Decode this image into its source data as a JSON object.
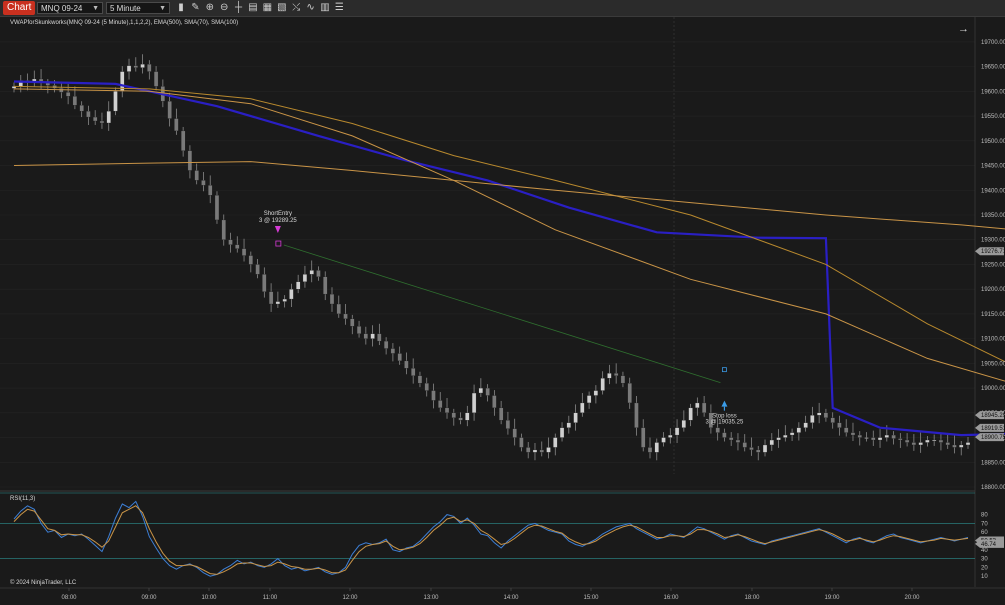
{
  "toolbar": {
    "chart_tab": "Chart",
    "instrument": "MNQ 09-24",
    "interval": "5 Minute",
    "icons": [
      "bar-type-icon",
      "draw-tool-icon",
      "zoom-in-icon",
      "zoom-out-icon",
      "crosshair-icon",
      "properties-icon",
      "data-box-icon",
      "templates-icon",
      "strategies-icon",
      "indicators-icon",
      "chart-trader-icon",
      "list-icon"
    ]
  },
  "colors": {
    "background": "#1a1a1a",
    "candle_up": "#d0d0d0",
    "candle_down": "#7a7a7a",
    "vwap": "#2a1fc4",
    "ema": "#c99447",
    "sma70": "#c99447",
    "sma100": "#b8892e",
    "rsi": "#3d7fd6",
    "rsi_avg": "#c99447",
    "short_entry": "#d63ad6",
    "stop_loss": "#3a9be6"
  },
  "chart_data": [
    {
      "type": "candlestick",
      "title": "VWAPforSkunkworks(MNQ 09-24 (5 Minute),1,1,2,2), EMA(500), SMA(70), SMA(100)",
      "ylim": [
        18800,
        19720
      ],
      "y_ticks": [
        "19700.00",
        "19650.00",
        "19600.00",
        "19550.00",
        "19500.00",
        "19450.00",
        "19400.00",
        "19350.00",
        "19300.00",
        "19250.00",
        "19200.00",
        "19150.00",
        "19100.00",
        "19050.00",
        "19000.00",
        "18950.00",
        "18900.00",
        "18850.00",
        "18800.00"
      ],
      "x_ticks": [
        "08:00",
        "09:00",
        "10:00",
        "11:00",
        "12:00",
        "13:00",
        "14:00",
        "15:00",
        "16:00",
        "18:00",
        "19:00",
        "20:00"
      ],
      "price_labels": [
        {
          "text": "19276.71",
          "value": 19276.71
        },
        {
          "text": "18945.29",
          "value": 18945.29
        },
        {
          "text": "18919.51",
          "value": 18919.51
        },
        {
          "text": "18900.75",
          "value": 18900.75
        }
      ],
      "candles_close": [
        19610,
        19622,
        19618,
        19625,
        19617,
        19612,
        19606,
        19598,
        19590,
        19572,
        19560,
        19548,
        19540,
        19536,
        19560,
        19600,
        19640,
        19652,
        19648,
        19655,
        19640,
        19610,
        19580,
        19545,
        19520,
        19480,
        19440,
        19420,
        19410,
        19390,
        19340,
        19300,
        19290,
        19282,
        19268,
        19250,
        19230,
        19195,
        19170,
        19175,
        19180,
        19200,
        19215,
        19230,
        19238,
        19225,
        19190,
        19170,
        19150,
        19140,
        19125,
        19110,
        19100,
        19110,
        19095,
        19080,
        19070,
        19055,
        19040,
        19025,
        19010,
        18995,
        18975,
        18960,
        18950,
        18940,
        18935,
        18950,
        18990,
        19000,
        18985,
        18960,
        18935,
        18918,
        18900,
        18880,
        18870,
        18875,
        18870,
        18880,
        18900,
        18920,
        18930,
        18950,
        18970,
        18985,
        18995,
        19020,
        19030,
        19025,
        19010,
        18970,
        18920,
        18880,
        18870,
        18890,
        18900,
        18905,
        18920,
        18935,
        18960,
        18970,
        18950,
        18920,
        18910,
        18900,
        18895,
        18890,
        18880,
        18875,
        18870,
        18885,
        18895,
        18900,
        18905,
        18910,
        18920,
        18930,
        18945,
        18950,
        18940,
        18930,
        18920,
        18910,
        18905,
        18900,
        18900,
        18895,
        18900,
        18905,
        18898,
        18895,
        18890,
        18885,
        18890,
        18895,
        18895,
        18890,
        18885,
        18880,
        18885,
        18890
      ],
      "series": [
        {
          "name": "VWAP",
          "points": [
            [
              0,
              19620
            ],
            [
              15,
              19615
            ],
            [
              30,
              19570
            ],
            [
              45,
              19510
            ],
            [
              58,
              19460
            ],
            [
              70,
              19420
            ],
            [
              82,
              19365
            ],
            [
              95,
              19315
            ],
            [
              110,
              19304
            ],
            [
              120,
              19303
            ],
            [
              121,
              18960
            ],
            [
              128,
              18920
            ],
            [
              140,
              18905
            ],
            [
              155,
              18910
            ],
            [
              170,
              18900
            ],
            [
              182,
              18895
            ]
          ]
        },
        {
          "name": "SMA(70)",
          "points": [
            [
              0,
              19605
            ],
            [
              20,
              19600
            ],
            [
              35,
              19575
            ],
            [
              50,
              19510
            ],
            [
              65,
              19420
            ],
            [
              80,
              19320
            ],
            [
              100,
              19220
            ],
            [
              120,
              19150
            ],
            [
              135,
              19060
            ],
            [
              150,
              19000
            ],
            [
              165,
              18965
            ],
            [
              182,
              18945
            ]
          ]
        },
        {
          "name": "SMA(100)",
          "points": [
            [
              0,
              19610
            ],
            [
              20,
              19605
            ],
            [
              35,
              19585
            ],
            [
              50,
              19535
            ],
            [
              65,
              19470
            ],
            [
              80,
              19420
            ],
            [
              100,
              19350
            ],
            [
              120,
              19250
            ],
            [
              135,
              19130
            ],
            [
              150,
              19030
            ],
            [
              165,
              18960
            ],
            [
              182,
              18920
            ]
          ]
        },
        {
          "name": "EMA(500)",
          "points": [
            [
              0,
              19450
            ],
            [
              20,
              19455
            ],
            [
              35,
              19458
            ],
            [
              50,
              19440
            ],
            [
              65,
              19420
            ],
            [
              80,
              19400
            ],
            [
              100,
              19375
            ],
            [
              120,
              19350
            ],
            [
              140,
              19330
            ],
            [
              160,
              19305
            ],
            [
              182,
              19276
            ]
          ]
        }
      ],
      "annotations": [
        {
          "text": "ShortEntry",
          "sub": "3 @ 19289.25",
          "bar": 39,
          "price": 19289.25
        },
        {
          "text": "Stop loss",
          "sub": "3 @ 19035.25",
          "bar": 105,
          "price": 19035.25
        }
      ],
      "ylabel": "",
      "xlabel": ""
    },
    {
      "type": "line",
      "title": "RSI(11,3)",
      "ylim": [
        0,
        100
      ],
      "y_ticks": [
        "80",
        "70",
        "60",
        "50",
        "40",
        "30",
        "20",
        "10"
      ],
      "series": [
        {
          "name": "RSI",
          "values": [
            75,
            84,
            90,
            86,
            70,
            60,
            62,
            54,
            58,
            56,
            58,
            52,
            45,
            38,
            55,
            76,
            92,
            88,
            95,
            78,
            55,
            42,
            30,
            22,
            18,
            22,
            24,
            20,
            14,
            10,
            12,
            18,
            22,
            28,
            24,
            26,
            22,
            20,
            24,
            30,
            22,
            18,
            20,
            16,
            18,
            20,
            15,
            12,
            14,
            20,
            35,
            45,
            48,
            46,
            48,
            52,
            40,
            38,
            42,
            44,
            50,
            58,
            66,
            72,
            80,
            78,
            70,
            76,
            68,
            58,
            56,
            48,
            42,
            50,
            56,
            62,
            68,
            70,
            66,
            62,
            60,
            58,
            50,
            46,
            44,
            48,
            52,
            58,
            62,
            66,
            68,
            70,
            64,
            60,
            56,
            52,
            54,
            58,
            56,
            54,
            60,
            66,
            64,
            60,
            56,
            52,
            56,
            58,
            54,
            50,
            48,
            46,
            50,
            52,
            54,
            56,
            58,
            60,
            62,
            64,
            60,
            56,
            52,
            48,
            52,
            54,
            50,
            48,
            52,
            56,
            58,
            54,
            52,
            50,
            48,
            50,
            52,
            54,
            52,
            50,
            52,
            54
          ]
        },
        {
          "name": "RSI Avg",
          "values": [
            72,
            80,
            86,
            84,
            74,
            64,
            62,
            57,
            58,
            57,
            57,
            54,
            49,
            43,
            50,
            66,
            82,
            86,
            90,
            82,
            64,
            49,
            36,
            27,
            22,
            22,
            23,
            21,
            17,
            13,
            12,
            15,
            19,
            24,
            25,
            25,
            23,
            21,
            22,
            26,
            24,
            21,
            20,
            18,
            18,
            19,
            17,
            14,
            14,
            17,
            28,
            38,
            44,
            46,
            47,
            50,
            44,
            40,
            41,
            43,
            47,
            54,
            62,
            68,
            75,
            77,
            72,
            74,
            70,
            62,
            58,
            52,
            46,
            48,
            53,
            59,
            65,
            68,
            67,
            64,
            61,
            59,
            53,
            49,
            46,
            47,
            50,
            55,
            59,
            63,
            66,
            68,
            66,
            62,
            58,
            54,
            54,
            56,
            56,
            55,
            58,
            63,
            63,
            61,
            58,
            54,
            55,
            57,
            55,
            52,
            49,
            47,
            49,
            51,
            53,
            55,
            57,
            59,
            61,
            63,
            61,
            58,
            54,
            50,
            51,
            53,
            51,
            49,
            51,
            54,
            56,
            55,
            53,
            51,
            49,
            50,
            51,
            53,
            52,
            51,
            52,
            53
          ]
        }
      ],
      "value_labels": [
        {
          "text": "50.53",
          "value": 50.53
        },
        {
          "text": "46.74",
          "value": 46.74
        }
      ],
      "lines": [
        70,
        30
      ]
    }
  ],
  "footer": "© 2024 NinjaTrader, LLC"
}
